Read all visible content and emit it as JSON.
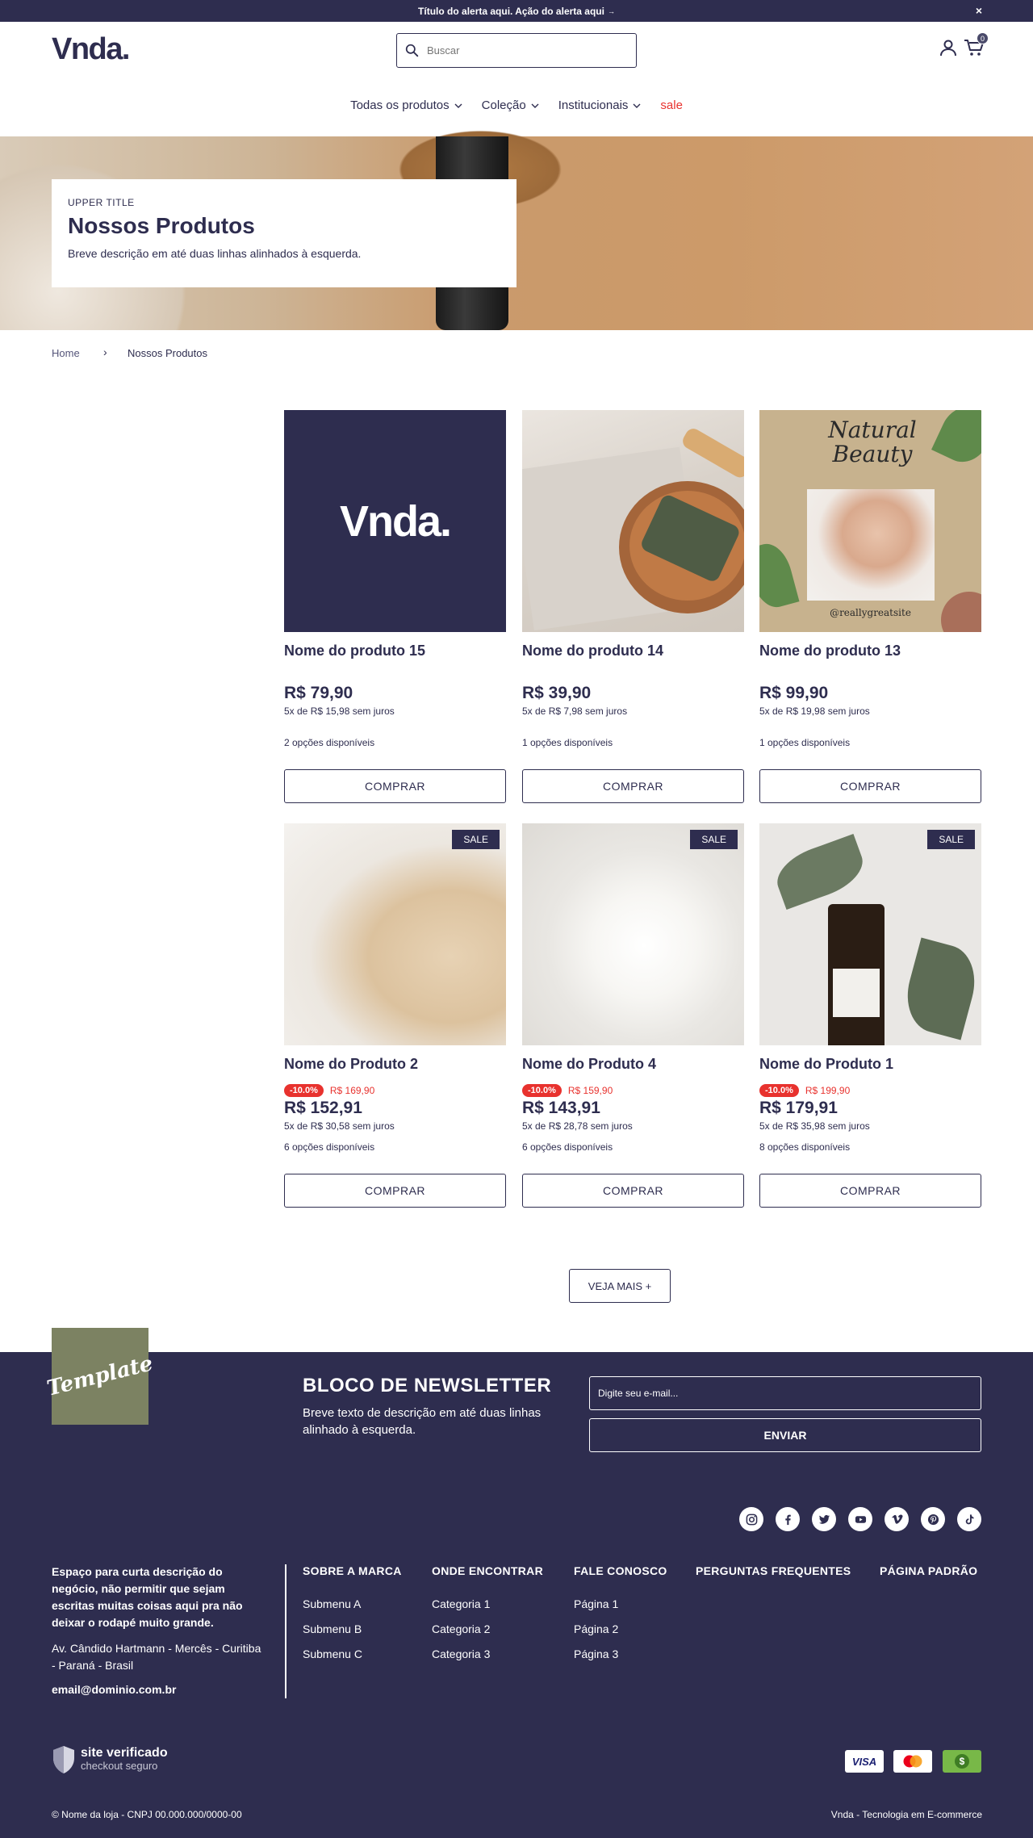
{
  "alert": {
    "text": "Título do alerta aqui. Ação do alerta aqui",
    "arrow": "→",
    "close": "×"
  },
  "header": {
    "logo": "Vnda.",
    "search_placeholder": "Buscar",
    "cart_count": "0",
    "icons": [
      "search-icon",
      "user-icon",
      "cart-icon"
    ]
  },
  "nav": {
    "items": [
      "Todas os produtos",
      "Coleção",
      "Institucionais"
    ],
    "sale": "sale"
  },
  "hero": {
    "upper": "UPPER TITLE",
    "title": "Nossos Produtos",
    "desc": "Breve descrição em até duas linhas alinhados à esquerda."
  },
  "breadcrumb": {
    "home": "Home",
    "separator": "›",
    "current": "Nossos Produtos"
  },
  "products": [
    {
      "name": "Nome do produto 15",
      "price": "R$ 79,90",
      "installments": "5x de R$ 15,98 sem juros",
      "options": "2 opções disponíveis",
      "buy": "COMPRAR",
      "image_logo": "Vnda."
    },
    {
      "name": "Nome do produto 14",
      "price": "R$ 39,90",
      "installments": "5x de R$ 7,98 sem juros",
      "options": "1 opções disponíveis",
      "buy": "COMPRAR"
    },
    {
      "name": "Nome do produto 13",
      "price": "R$ 99,90",
      "installments": "5x de R$ 19,98 sem juros",
      "options": "1 opções disponíveis",
      "buy": "COMPRAR",
      "image_title_1": "Natural",
      "image_title_2": "Beauty",
      "image_handle": "@reallygreatsite"
    },
    {
      "name": "Nome do Produto 2",
      "badge": "SALE",
      "discount": "-10.0%",
      "old_price": "R$ 169,90",
      "price": "R$ 152,91",
      "installments": "5x de R$ 30,58 sem juros",
      "options": "6 opções disponíveis",
      "buy": "COMPRAR"
    },
    {
      "name": "Nome do Produto 4",
      "badge": "SALE",
      "discount": "-10.0%",
      "old_price": "R$ 159,90",
      "price": "R$ 143,91",
      "installments": "5x de R$ 28,78 sem juros",
      "options": "6 opções disponíveis",
      "buy": "COMPRAR"
    },
    {
      "name": "Nome do Produto 1",
      "badge": "SALE",
      "discount": "-10.0%",
      "old_price": "R$ 199,90",
      "price": "R$ 179,91",
      "installments": "5x de R$ 35,98 sem juros",
      "options": "8 opções disponíveis",
      "buy": "COMPRAR"
    }
  ],
  "more_button": "VEJA MAIS +",
  "footer": {
    "template_logo": "Template",
    "newsletter": {
      "title": "BLOCO DE NEWSLETTER",
      "desc": "Breve texto de descrição em até duas linhas alinhado à esquerda.",
      "placeholder": "Digite seu e-mail...",
      "button": "ENVIAR"
    },
    "social": [
      "instagram-icon",
      "facebook-icon",
      "twitter-icon",
      "youtube-icon",
      "vimeo-icon",
      "pinterest-icon",
      "tiktok-icon"
    ],
    "about": "Espaço para curta descrição do negócio, não permitir que sejam escritas muitas coisas aqui pra não deixar o rodapé muito grande.",
    "address": "Av. Cândido Hartmann - Mercês - Curitiba - Paraná - Brasil",
    "email": "email@dominio.com.br",
    "columns": [
      {
        "title": "SOBRE A MARCA",
        "links": [
          "Submenu A",
          "Submenu B",
          "Submenu C"
        ]
      },
      {
        "title": "ONDE ENCONTRAR",
        "links": [
          "Categoria 1",
          "Categoria 2",
          "Categoria 3"
        ]
      },
      {
        "title": "FALE CONOSCO",
        "links": [
          "Página 1",
          "Página 2",
          "Página 3"
        ]
      },
      {
        "title": "PERGUNTAS FREQUENTES",
        "links": []
      },
      {
        "title": "PÁGINA PADRÃO",
        "links": []
      }
    ],
    "verified_1": "site verificado",
    "verified_2": "checkout seguro",
    "payments": {
      "visa": "VISA",
      "money": "$"
    },
    "copyright": "© Nome da loja - CNPJ 00.000.000/0000-00",
    "tech": "Vnda - Tecnologia em E-commerce"
  },
  "colors": {
    "brand": "#2e2d4f",
    "sale": "#e8322e",
    "template_bg": "#7c8262"
  }
}
